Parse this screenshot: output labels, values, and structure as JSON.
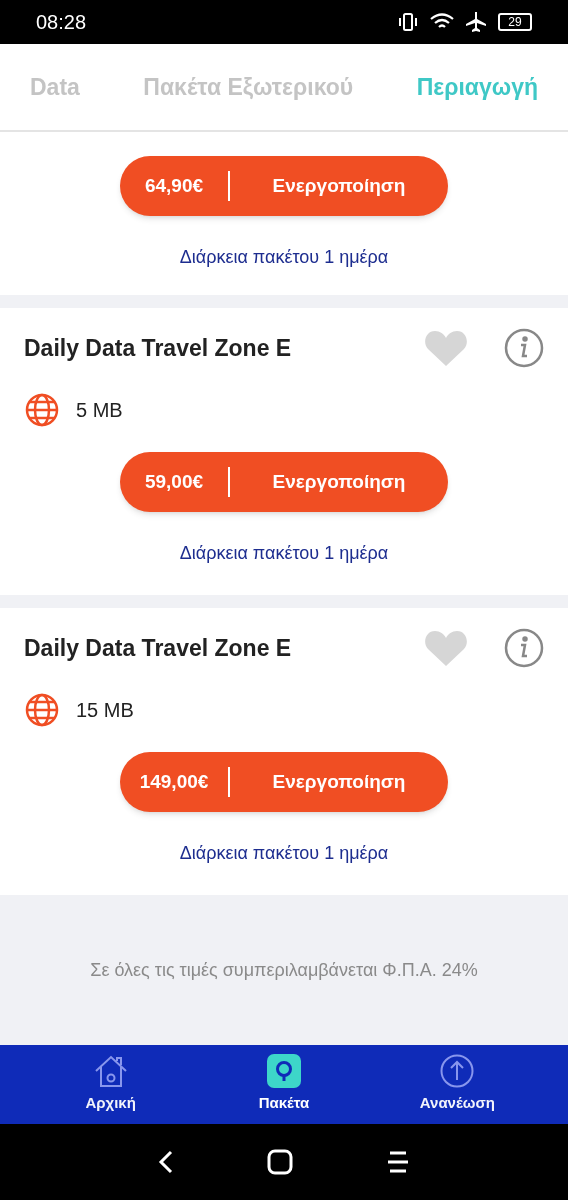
{
  "status_bar": {
    "time": "08:28",
    "battery": "29"
  },
  "tabs": [
    {
      "label": "Data",
      "selected": false
    },
    {
      "label": "Πακέτα Εξωτερικού",
      "selected": false
    },
    {
      "label": "Περιαγωγή",
      "selected": true
    }
  ],
  "packages": [
    {
      "price": "64,90€",
      "action": "Ενεργοποίηση",
      "duration": "Διάρκεια πακέτου 1 ημέρα"
    },
    {
      "title": "Daily Data Travel Zone E",
      "favorite": false,
      "data": "5 MB",
      "price": "59,00€",
      "action": "Ενεργοποίηση",
      "duration": "Διάρκεια πακέτου 1 ημέρα"
    },
    {
      "title": "Daily Data Travel Zone E",
      "favorite": false,
      "data": "15 MB",
      "price": "149,00€",
      "action": "Ενεργοποίηση",
      "duration": "Διάρκεια πακέτου 1 ημέρα"
    }
  ],
  "vat_note": "Σε όλες τις τιμές συμπεριλαμβάνεται Φ.Π.Α. 24%",
  "bottom_nav": [
    {
      "label": "Αρχική",
      "kind": "home",
      "selected": false
    },
    {
      "label": "Πακέτα",
      "kind": "packages",
      "selected": true
    },
    {
      "label": "Ανανέωση",
      "kind": "renew",
      "selected": false
    }
  ]
}
